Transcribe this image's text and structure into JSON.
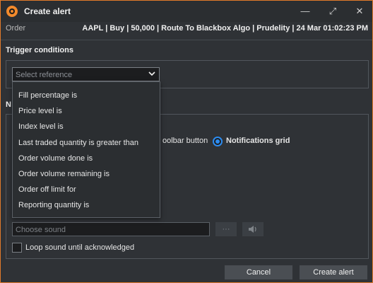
{
  "window": {
    "title": "Create alert",
    "minimize_glyph": "—",
    "maximize_glyph": "⤢",
    "close_glyph": "✕"
  },
  "order": {
    "label": "Order",
    "value": "AAPL | Buy | 50,000 | Route To Blackbox Algo | Prudelity | 24 Mar 01:02:23 PM"
  },
  "trigger": {
    "section_title": "Trigger conditions",
    "select_placeholder": "Select reference",
    "options": [
      "Fill percentage is",
      "Price level is",
      "Index level is",
      "Last traded quantity is greater than",
      "Order volume done is",
      "Order volume remaining is",
      "Order off limit for",
      "Reporting quantity is"
    ]
  },
  "notification": {
    "section_title_fragment": "N",
    "toolbar_option_fragment": "oolbar button",
    "grid_option": "Notifications grid",
    "grid_selected": true
  },
  "sound": {
    "placeholder": "Choose sound",
    "browse_glyph": "···",
    "play_glyph": "🔈",
    "loop_label": "Loop sound until acknowledged",
    "loop_checked": false
  },
  "footer": {
    "cancel_label": "Cancel",
    "create_label": "Create alert"
  },
  "colors": {
    "accent_border": "#e07a2a",
    "radio_blue": "#2d8cf0"
  }
}
